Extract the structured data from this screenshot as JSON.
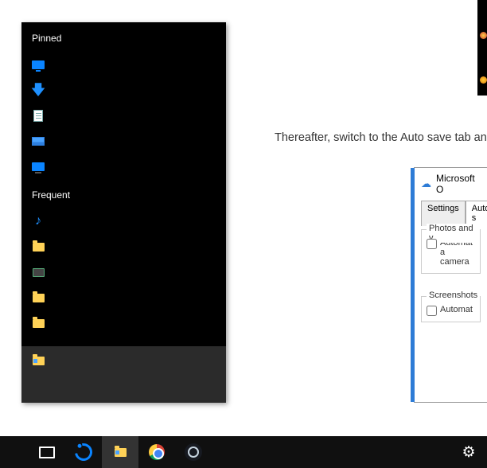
{
  "jumplist": {
    "pinned_title": "Pinned",
    "frequent_title": "Frequent",
    "pinned_items": [
      {
        "icon": "desktop-icon"
      },
      {
        "icon": "download-arrow-icon"
      },
      {
        "icon": "document-icon"
      },
      {
        "icon": "pictures-icon"
      },
      {
        "icon": "this-pc-icon"
      }
    ],
    "frequent_items": [
      {
        "icon": "music-icon"
      },
      {
        "icon": "folder-icon"
      },
      {
        "icon": "dark-folder-icon"
      },
      {
        "icon": "folder-icon"
      },
      {
        "icon": "folder-icon"
      }
    ],
    "footer_app": "File Explorer"
  },
  "article": {
    "line": "Thereafter, switch to the Auto save tab and"
  },
  "onedrive": {
    "title": "Microsoft O",
    "tabs": {
      "settings": "Settings",
      "autosave": "Auto s"
    },
    "group_photos_title": "Photos and v",
    "cb_photos_line1": "Automat",
    "cb_photos_line2": "a camera",
    "group_screens_title": "Screenshots",
    "cb_screens": "Automat"
  },
  "taskbar": {
    "items": [
      "task-view",
      "edge",
      "file-explorer",
      "chrome",
      "steam"
    ],
    "right": [
      "settings-gear"
    ]
  }
}
